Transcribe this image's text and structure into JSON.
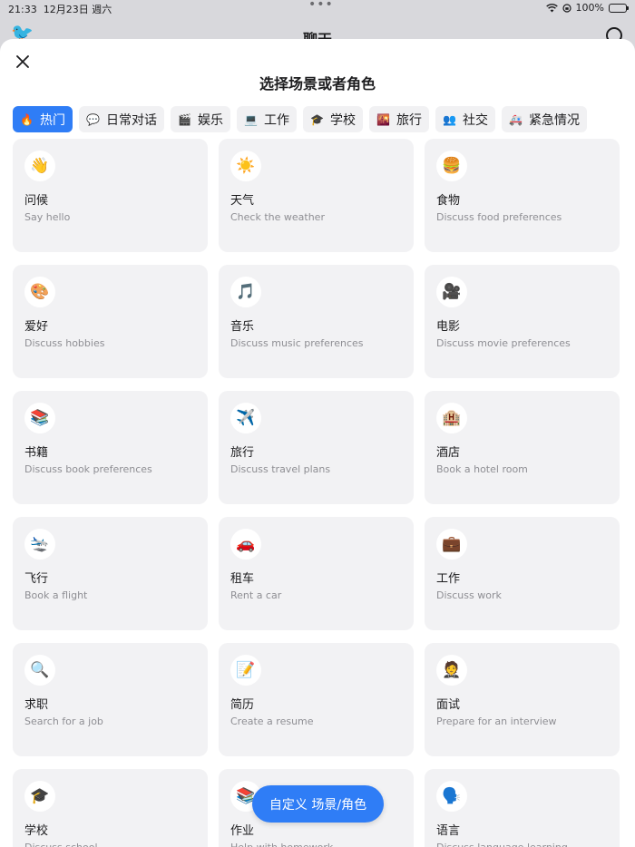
{
  "status_bar": {
    "time": "21:33",
    "date": "12月23日 週六",
    "dots": "•••",
    "battery": "100%"
  },
  "background_page": {
    "title": "聊天"
  },
  "sheet": {
    "title": "选择场景或者角色",
    "close_label": "close"
  },
  "tabs": [
    {
      "label": "热门",
      "icon": "🔥",
      "active": true
    },
    {
      "label": "日常对话",
      "icon": "💬",
      "active": false
    },
    {
      "label": "娱乐",
      "icon": "🎬",
      "active": false
    },
    {
      "label": "工作",
      "icon": "💻",
      "active": false
    },
    {
      "label": "学校",
      "icon": "🎓",
      "active": false
    },
    {
      "label": "旅行",
      "icon": "🌇",
      "active": false
    },
    {
      "label": "社交",
      "icon": "👥",
      "active": false
    },
    {
      "label": "紧急情况",
      "icon": "🚑",
      "active": false
    }
  ],
  "cards": [
    {
      "title": "问候",
      "subtitle": "Say hello",
      "icon": "👋"
    },
    {
      "title": "天气",
      "subtitle": "Check the weather",
      "icon": "☀️"
    },
    {
      "title": "食物",
      "subtitle": "Discuss food preferences",
      "icon": "🍔"
    },
    {
      "title": "爱好",
      "subtitle": "Discuss hobbies",
      "icon": "🎨"
    },
    {
      "title": "音乐",
      "subtitle": "Discuss music preferences",
      "icon": "🎵"
    },
    {
      "title": "电影",
      "subtitle": "Discuss movie preferences",
      "icon": "🎥"
    },
    {
      "title": "书籍",
      "subtitle": "Discuss book preferences",
      "icon": "📚"
    },
    {
      "title": "旅行",
      "subtitle": "Discuss travel plans",
      "icon": "✈️"
    },
    {
      "title": "酒店",
      "subtitle": "Book a hotel room",
      "icon": "🏨"
    },
    {
      "title": "飞行",
      "subtitle": "Book a flight",
      "icon": "🛬"
    },
    {
      "title": "租车",
      "subtitle": "Rent a car",
      "icon": "🚗"
    },
    {
      "title": "工作",
      "subtitle": "Discuss work",
      "icon": "💼"
    },
    {
      "title": "求职",
      "subtitle": "Search for a job",
      "icon": "🔍"
    },
    {
      "title": "简历",
      "subtitle": "Create a resume",
      "icon": "📝"
    },
    {
      "title": "面试",
      "subtitle": "Prepare for an interview",
      "icon": "🤵"
    },
    {
      "title": "学校",
      "subtitle": "Discuss school",
      "icon": "🎓"
    },
    {
      "title": "作业",
      "subtitle": "Help with homework",
      "icon": "📚"
    },
    {
      "title": "语言",
      "subtitle": "Discuss language learning",
      "icon": "🗣️"
    }
  ],
  "fab": {
    "label": "自定义 场景/角色"
  },
  "colors": {
    "accent": "#2f7df6",
    "card_bg": "#f2f2f4",
    "muted_text": "#8e8e93"
  }
}
